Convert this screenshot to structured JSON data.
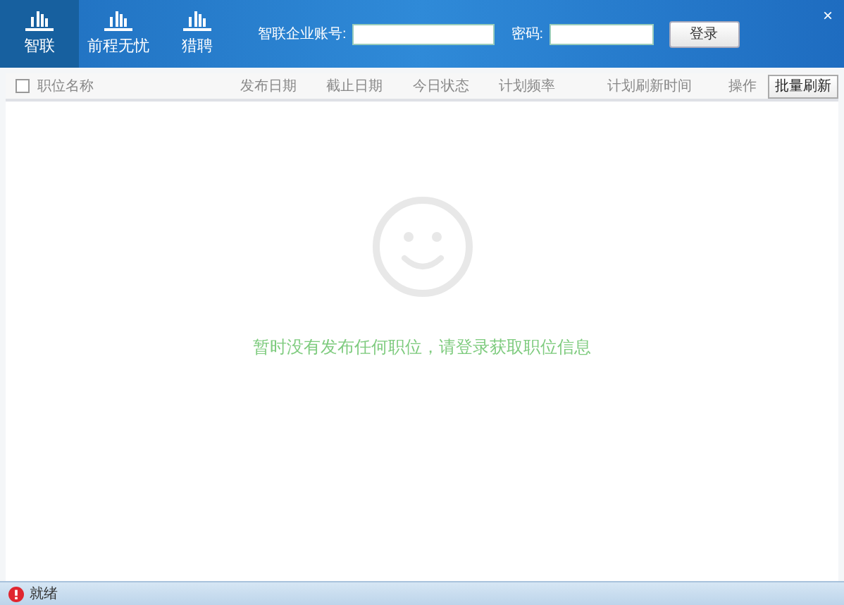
{
  "tabs": [
    {
      "label": "智联",
      "selected": true
    },
    {
      "label": "前程无忧",
      "selected": false
    },
    {
      "label": "猎聘",
      "selected": false
    }
  ],
  "login": {
    "account_label": "智联企业账号:",
    "password_label": "密码:",
    "button": "登录"
  },
  "close": "×",
  "table": {
    "select_all": {
      "checked": false
    },
    "columns": [
      "职位名称",
      "发布日期",
      "截止日期",
      "今日状态",
      "计划频率",
      "计划刷新时间"
    ],
    "action_label": "操作",
    "batch_button": "批量刷新"
  },
  "empty_message": "暂时没有发布任何职位，请登录获取职位信息",
  "status_bar": {
    "text": "就绪"
  }
}
